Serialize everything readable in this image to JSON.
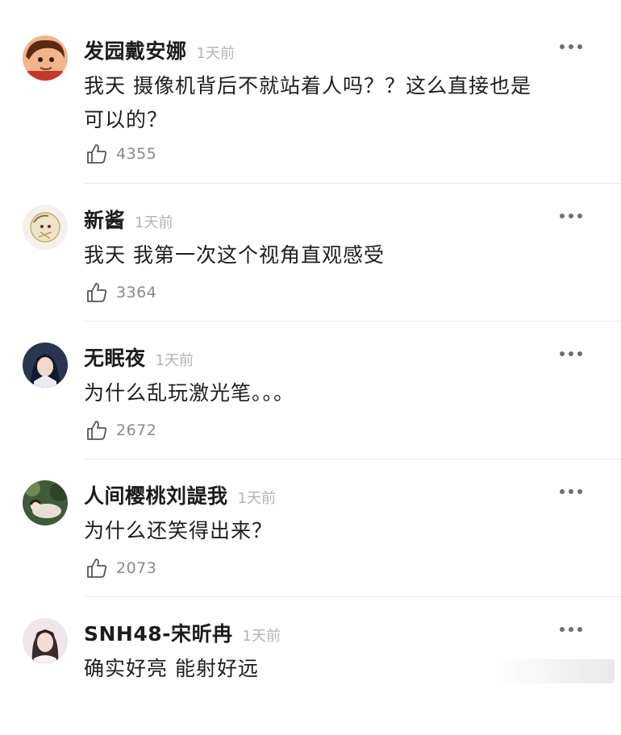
{
  "comments": [
    {
      "username": "发园戴安娜",
      "time": "1天前",
      "text_line1": "我天 摄像机背后不就站着人吗？？这么直接也是",
      "text_line2": "可以的？",
      "likes": "4355",
      "avatar": "avatar-cartoon-boy"
    },
    {
      "username": "新酱",
      "time": "1天前",
      "text_line1": "我天 我第一次这个视角直观感受",
      "likes": "3364",
      "avatar": "avatar-doodle"
    },
    {
      "username": "无眠夜",
      "time": "1天前",
      "text_line1": "为什么乱玩激光笔。。。",
      "likes": "2672",
      "avatar": "avatar-anime-girl"
    },
    {
      "username": "人间樱桃刘諟我",
      "time": "1天前",
      "text_line1": "为什么还笑得出来？",
      "likes": "2073",
      "avatar": "avatar-photo"
    },
    {
      "username": "SNH48-宋昕冉",
      "time": "1天前",
      "text_line1": "确实好亮  能射好远",
      "avatar": "avatar-idol"
    }
  ],
  "icons": {
    "like": "thumbs-up-icon",
    "more": "more-dots-icon"
  },
  "colors": {
    "username": "#1c1c1c",
    "time": "#b3b3b3",
    "like_count": "#8a8a8a",
    "divider": "#ececec"
  }
}
